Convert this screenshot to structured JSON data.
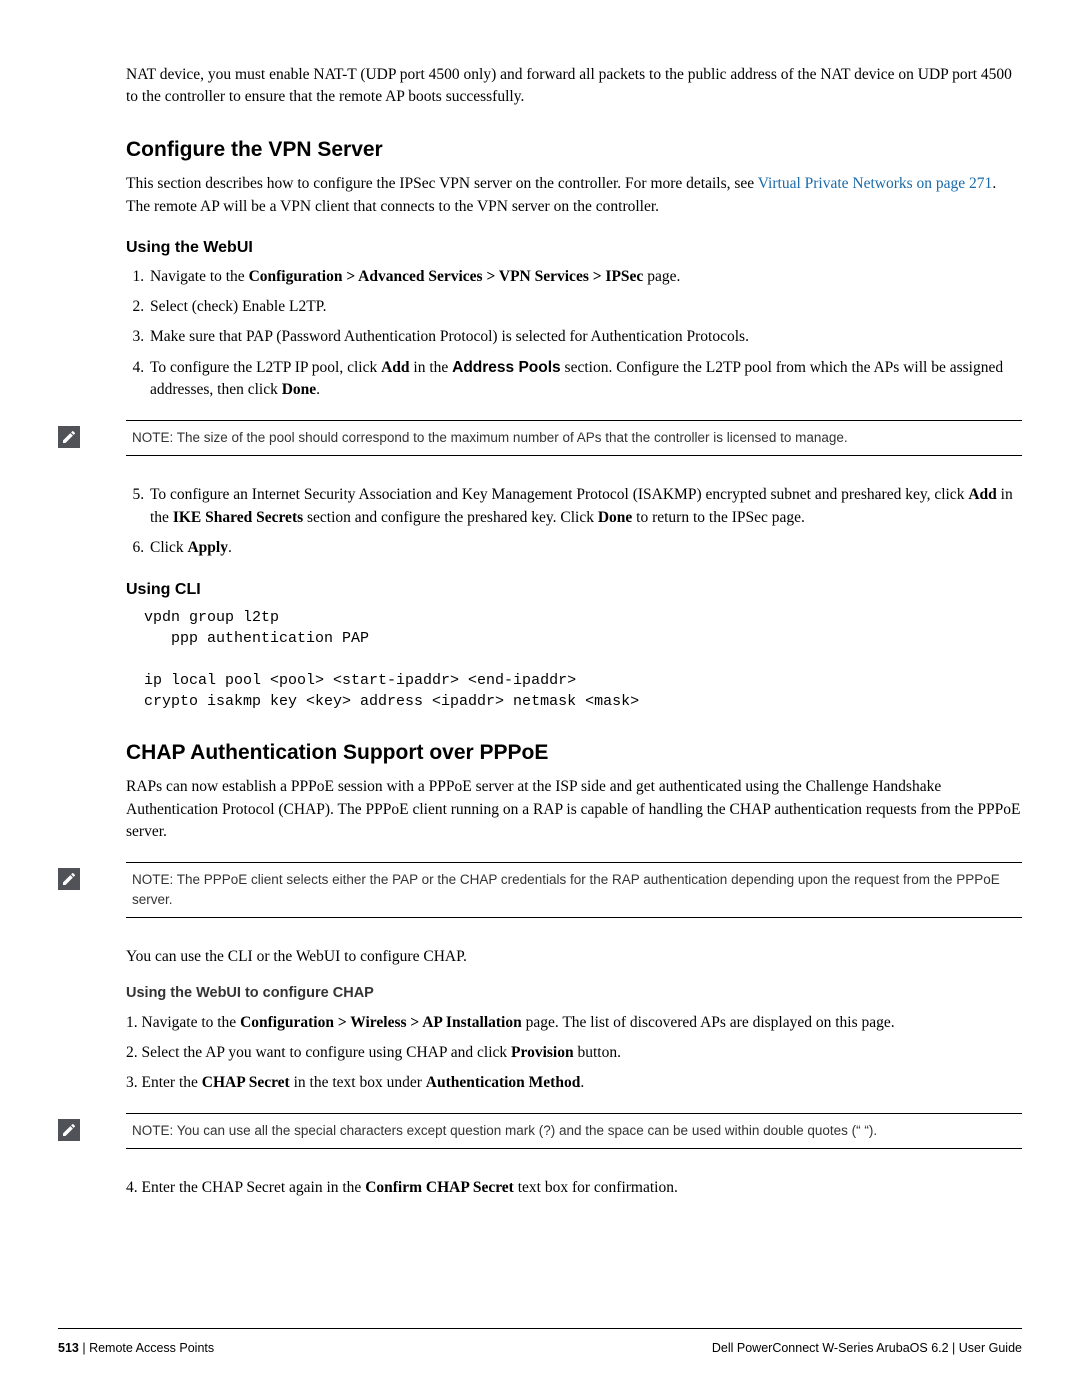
{
  "intro_para": "NAT device, you must enable NAT-T (UDP port 4500 only) and forward all packets to the public address of the NAT device on UDP port 4500 to the controller to ensure that the remote AP boots successfully.",
  "sec1": {
    "title": "Configure the VPN Server",
    "para_pre": "This section describes how to configure the IPSec VPN server on the controller. For more details, see ",
    "link": "Virtual Private Networks on page 271",
    "para_post": ". The remote AP will be a VPN client that connects to the VPN server on the controller.",
    "webui_heading": "Using the WebUI",
    "steps_a": {
      "s1_pre": "Navigate to the ",
      "s1_bold": "Configuration > Advanced Services > VPN Services > IPSec",
      "s1_post": " page.",
      "s2": "Select (check) Enable L2TP.",
      "s3": "Make sure that PAP (Password Authentication Protocol) is selected for Authentication Protocols.",
      "s4_pre": "To configure the L2TP IP pool, click ",
      "s4_b1": "Add",
      "s4_mid1": " in the ",
      "s4_sans": "Address Pools",
      "s4_mid2": " section. Configure the L2TP pool from which the APs will be assigned addresses, then click ",
      "s4_b2": "Done",
      "s4_post": "."
    },
    "note1": "NOTE: The size of the pool should correspond to the maximum number of APs that the controller is licensed to manage.",
    "steps_b": {
      "s5_pre": "To configure an Internet Security Association and Key Management Protocol (ISAKMP) encrypted subnet and preshared key, click ",
      "s5_b1": "Add",
      "s5_mid1": " in the ",
      "s5_b2": "IKE Shared Secrets",
      "s5_mid2": " section and configure the preshared key. Click ",
      "s5_b3": "Done",
      "s5_mid3": " to return to the IPSec page.",
      "s6_pre": "Click ",
      "s6_b": "Apply",
      "s6_post": "."
    },
    "cli_heading": "Using CLI",
    "cli_code": "vpdn group l2tp\n   ppp authentication PAP\n\nip local pool <pool> <start-ipaddr> <end-ipaddr>\ncrypto isakmp key <key> address <ipaddr> netmask <mask>"
  },
  "sec2": {
    "title": "CHAP Authentication Support over PPPoE",
    "para1": "RAPs can now establish a PPPoE session with a PPPoE server at the ISP side and get authenticated using the Challenge Handshake Authentication Protocol (CHAP). The PPPoE client running on a RAP is capable of handling the CHAP authentication requests from the PPPoE server.",
    "note2": "NOTE: The PPPoE client selects either the PAP or the CHAP credentials for the RAP authentication depending upon the request from the PPPoE server.",
    "para2": "You can use the CLI or the WebUI to configure CHAP.",
    "webui_heading": "Using the WebUI to configure CHAP",
    "steps": {
      "s1_pre": "1. Navigate to the ",
      "s1_bold": "Configuration > Wireless > AP Installation",
      "s1_post": " page. The list of discovered APs are displayed on this page.",
      "s2_pre": "2. Select the AP you want to configure using CHAP and click ",
      "s2_bold": "Provision",
      "s2_post": " button.",
      "s3_pre": "3. Enter the ",
      "s3_b1": "CHAP Secret",
      "s3_mid": " in the text box under ",
      "s3_b2": "Authentication Method",
      "s3_post": "."
    },
    "note3": "NOTE: You can use all the special characters except question mark (?) and the space can be used within double quotes (“ “).",
    "steps2": {
      "s4_pre": "4. Enter the CHAP Secret again in the ",
      "s4_bold": "Confirm CHAP Secret",
      "s4_post": " text box for confirmation."
    }
  },
  "footer": {
    "page_num": "513",
    "sep": " | ",
    "left_text": "Remote Access Points",
    "right_text": "Dell PowerConnect W-Series ArubaOS 6.2  |  User Guide"
  }
}
